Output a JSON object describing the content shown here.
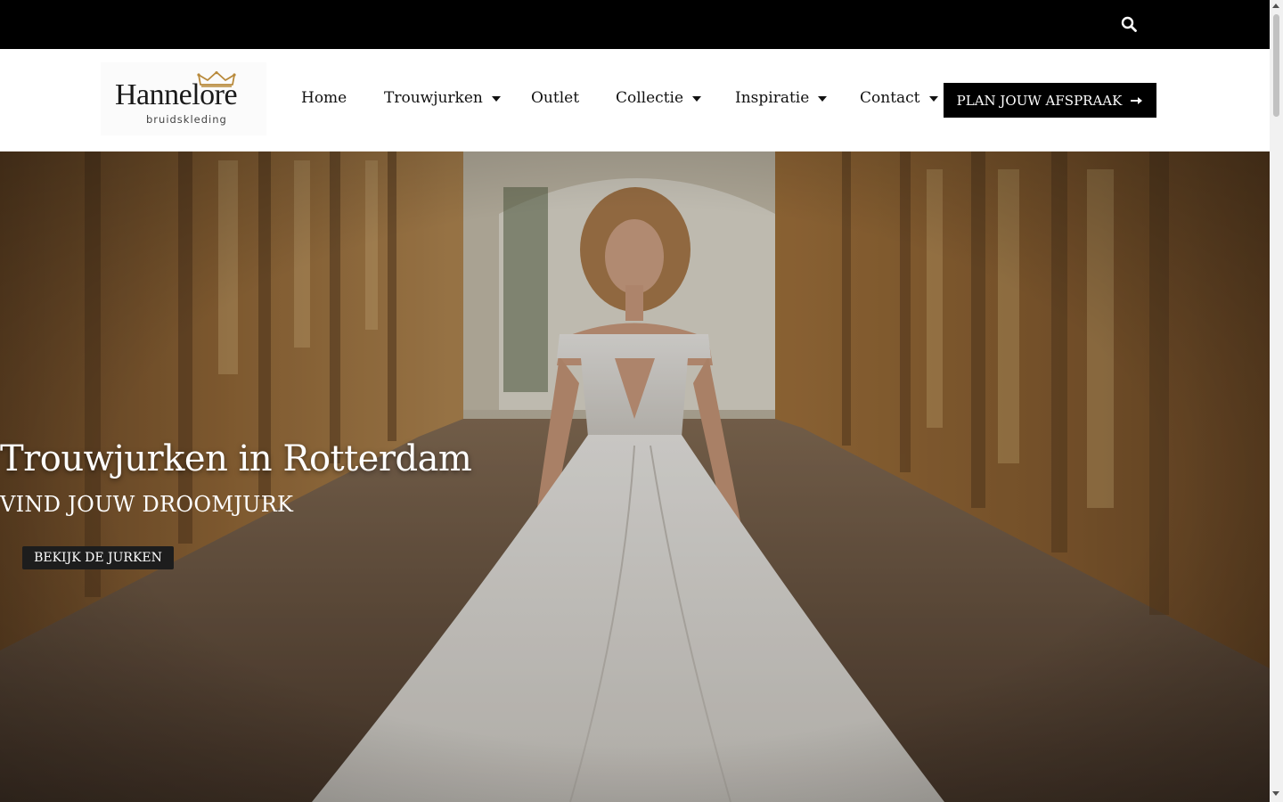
{
  "topbar": {
    "search_icon": "search-icon"
  },
  "logo": {
    "name": "Hannelore",
    "subtitle": "bruidskleding",
    "icon": "crown-icon"
  },
  "nav": {
    "items": [
      {
        "label": "Home",
        "has_dropdown": false
      },
      {
        "label": "Trouwjurken",
        "has_dropdown": true
      },
      {
        "label": "Outlet",
        "has_dropdown": false
      },
      {
        "label": "Collectie",
        "has_dropdown": true
      },
      {
        "label": "Inspiratie",
        "has_dropdown": true
      },
      {
        "label": "Contact",
        "has_dropdown": true
      }
    ],
    "cta_label": "PLAN JOUW AFSPRAAK",
    "cta_icon": "arrow-right-icon"
  },
  "hero": {
    "title": "Trouwjurken in Rotterdam",
    "subtitle": "VIND JOUW DROOMJURK",
    "button_label": "BEKIJK DE JURKEN"
  },
  "colors": {
    "topbar": "#000000",
    "cta_bg": "#000000",
    "hero_button_bg": "#1d1d1d"
  }
}
